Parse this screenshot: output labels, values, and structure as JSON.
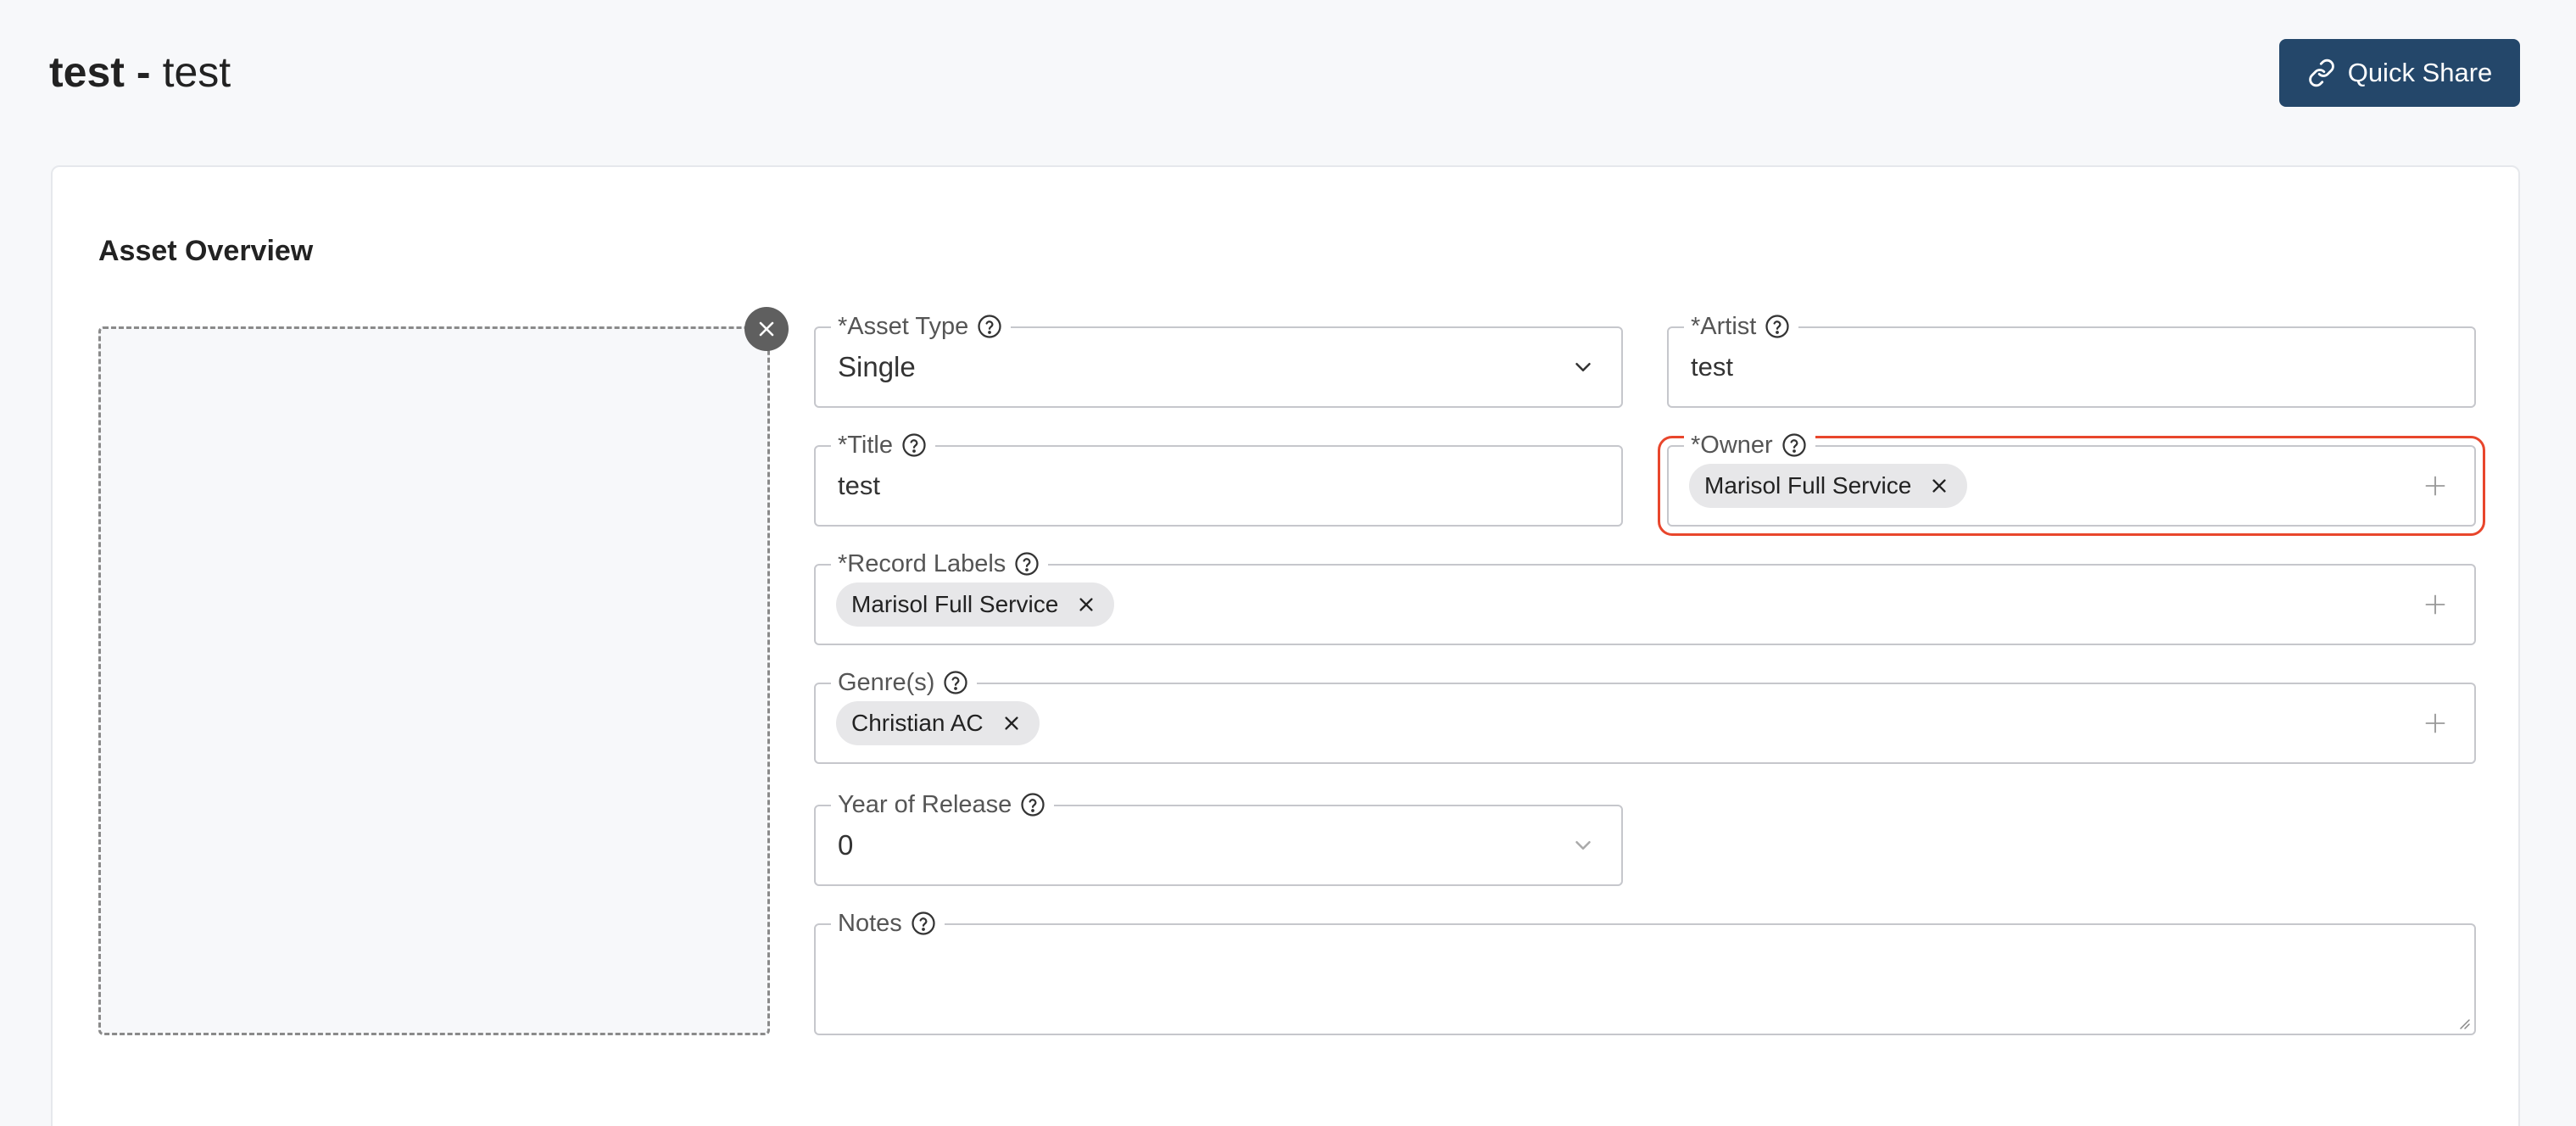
{
  "header": {
    "title_main": "test",
    "title_separator": "-",
    "title_sub": "test",
    "quick_share_label": "Quick Share"
  },
  "card": {
    "title": "Asset Overview"
  },
  "fields": {
    "asset_type": {
      "label": "*Asset Type",
      "value": "Single"
    },
    "artist": {
      "label": "*Artist",
      "value": "test"
    },
    "title": {
      "label": "*Title",
      "value": "test"
    },
    "owner": {
      "label": "*Owner",
      "chips": [
        "Marisol Full Service"
      ]
    },
    "record_labels": {
      "label": "*Record Labels",
      "chips": [
        "Marisol Full Service"
      ]
    },
    "genres": {
      "label": "Genre(s)",
      "chips": [
        "Christian AC"
      ]
    },
    "year_of_release": {
      "label": "Year of Release",
      "value": "0"
    },
    "notes": {
      "label": "Notes",
      "value": ""
    }
  },
  "icons": {
    "quick_share": "link-icon",
    "help": "question-circle-icon",
    "dropdown": "chevron-down-icon",
    "add": "plus-icon",
    "remove": "close-icon"
  },
  "colors": {
    "primary_button": "#24476a",
    "highlight": "#e8462c",
    "chip_bg": "#e7e7e9"
  }
}
